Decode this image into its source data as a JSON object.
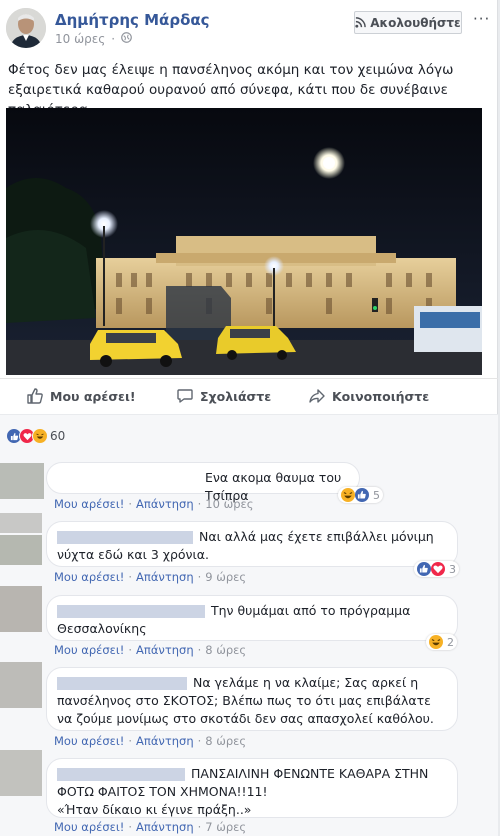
{
  "post": {
    "author": "Δημήτρης Μάρδας",
    "time": "10 ώρες",
    "follow_label": "Ακολουθήστε",
    "more": "···",
    "text": "Φέτος δεν μας έλειψε η πανσέληνος ακόμη και τον χειμώνα λόγω εξαιρετικά καθαρού ουρανού από σύνεφα, κάτι που δε συνέβαινε παλαιότερα.",
    "actions": {
      "like": "Μου αρέσει!",
      "comment": "Σχολιάστε",
      "share": "Κοινοποιήστε"
    },
    "reactions_count": "60"
  },
  "colors": {
    "link": "#365899",
    "like_blue": "#4267b2",
    "love_red": "#f0284a",
    "haha_yellow": "#f7b125"
  },
  "comments": [
    {
      "text": "Ενα ακομα θαυμα του Τσίπρα",
      "like": "Μου αρέσει!",
      "reply": "Απάντηση",
      "time": "10 ώρες",
      "reactions": "5"
    },
    {
      "text": "Ναι αλλά μας έχετε επιβάλλει μόνιμη νύχτα εδώ και 3 χρόνια.",
      "like": "Μου αρέσει!",
      "reply": "Απάντηση",
      "time": "9 ώρες",
      "reactions": "3"
    },
    {
      "text": "Την θυμάμαι από το πρόγραμμα Θεσσαλονίκης",
      "like": "Μου αρέσει!",
      "reply": "Απάντηση",
      "time": "8 ώρες",
      "reactions": "2"
    },
    {
      "text": "Να γελάμε η να κλαίμε; Σας αρκεί η πανσέληνος στο ΣΚΟΤΟΣ; Βλέπω πως το ότι μας επιβάλατε να ζούμε μονίμως στο σκοτάδι δεν σας απασχολεί καθόλου.",
      "like": "Μου αρέσει!",
      "reply": "Απάντηση",
      "time": "8 ώρες"
    },
    {
      "text": "ΠΑΝΣΑΙΛΙΝΗ ΦΕΝΩΝΤΕ ΚΑΘΑΡΑ ΣΤΗΝ ΦΟΤΩ ΦΑΙΤΟΣ ΤΟΝ ΧΗΜΟΝΑ!!11!",
      "quote": "«Ήταν δίκαιο κι έγινε πράξη..»",
      "like": "Μου αρέσει!",
      "reply": "Απάντηση",
      "time": "7 ώρες"
    }
  ]
}
